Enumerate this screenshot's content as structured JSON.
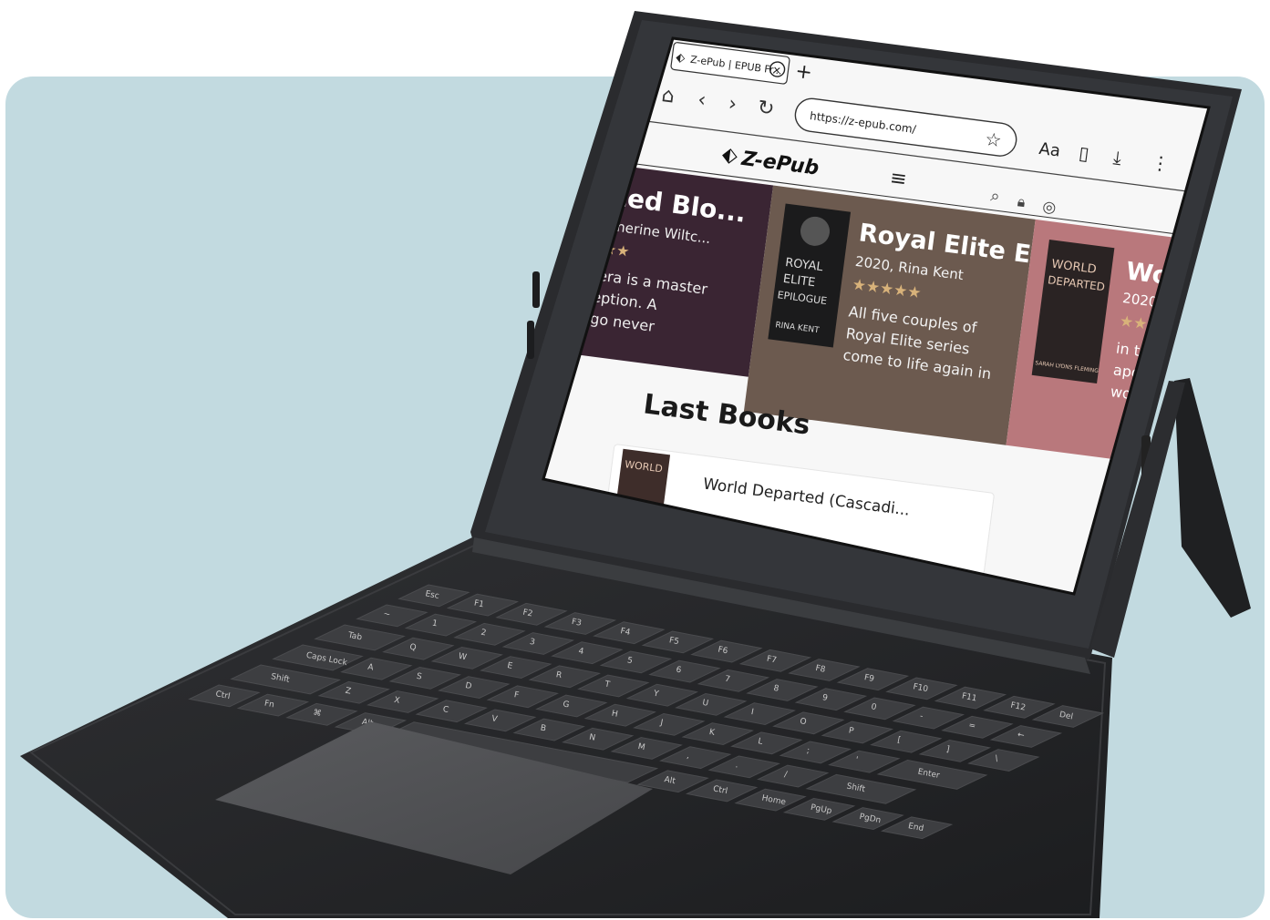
{
  "device": {
    "type": "e-ink tablet with keyboard folio",
    "colors": {
      "backdrop": "#c2dae0",
      "case": "#262729",
      "screen_bg": "#f7f7f7"
    }
  },
  "browser": {
    "tab_title": "Z-ePub | EPUB Fr...",
    "url": "https://z-epub.com/",
    "font_button": "Aa",
    "nav_icons": [
      "home-icon",
      "back-icon",
      "forward-icon",
      "reload-icon"
    ],
    "toolbar_icons": [
      "bookmark-star-icon",
      "reader-icon",
      "download-icon",
      "more-icon"
    ]
  },
  "site": {
    "logo": "Z-ePub",
    "header_icons": [
      "menu-icon",
      "search-icon",
      "lock-icon",
      "globe-icon"
    ]
  },
  "carousel": [
    {
      "title": "nted Blo...",
      "byline": "Catherine Wiltc...",
      "desc": [
        "rrera is a master",
        "ception. A",
        "ago never"
      ],
      "color": "#3a2533"
    },
    {
      "title": "Royal Elite E...",
      "byline": "2020, Rina Kent",
      "stars": 5,
      "desc": [
        "All five couples of",
        "Royal Elite series",
        "come to life again in"
      ],
      "cover": {
        "lines": [
          "ROYAL",
          "ELITE",
          "EPILOGUE"
        ],
        "author": "RINA KENT"
      },
      "color": "#6c5a4f"
    },
    {
      "title": "Wo",
      "byline": "2020,",
      "desc": [
        "in the",
        "apoc",
        "worst"
      ],
      "cover": {
        "lines": [
          "WORLD",
          "DEPARTED"
        ],
        "author": "SARAH LYONS FLEMING"
      },
      "color": "#b9787c"
    }
  ],
  "section": {
    "heading": "Last Books",
    "first_item_title": "World Departed (Cascadi...",
    "first_item_cover": "WORLD"
  },
  "keyboard": {
    "rows": [
      [
        "Esc",
        "F1",
        "F2",
        "F3",
        "F4",
        "F5",
        "F6",
        "F7",
        "F8",
        "F9",
        "F10",
        "F11",
        "F12",
        "Del"
      ],
      [
        "~",
        "1",
        "2",
        "3",
        "4",
        "5",
        "6",
        "7",
        "8",
        "9",
        "0",
        "-",
        "=",
        "←"
      ],
      [
        "Tab",
        "Q",
        "W",
        "E",
        "R",
        "T",
        "Y",
        "U",
        "I",
        "O",
        "P",
        "[",
        "]",
        "\\"
      ],
      [
        "Caps Lock",
        "A",
        "S",
        "D",
        "F",
        "G",
        "H",
        "J",
        "K",
        "L",
        ";",
        "'",
        "Enter"
      ],
      [
        "Shift",
        "Z",
        "X",
        "C",
        "V",
        "B",
        "N",
        "M",
        ",",
        ".",
        "/",
        "Shift"
      ],
      [
        "Ctrl",
        "Fn",
        "⌘",
        "Alt",
        "",
        "Alt",
        "Ctrl",
        "Home",
        "PgUp",
        "PgDn",
        "End"
      ]
    ]
  }
}
